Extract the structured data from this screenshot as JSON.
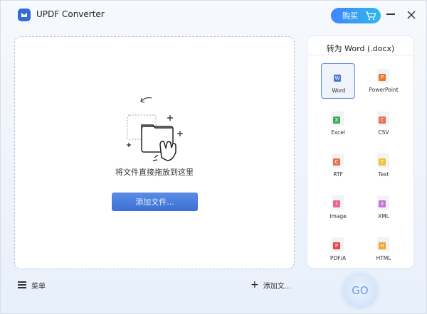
{
  "app": {
    "title": "UPDF Converter"
  },
  "titlebar": {
    "buy_label": "购买"
  },
  "dropzone": {
    "hint": "将文件直接拖放到这里",
    "add_button": "添加文件..."
  },
  "panel": {
    "title": "转为 Word (.docx)",
    "formats": [
      {
        "label": "Word",
        "badge": "W",
        "color": "#4a76d4",
        "selected": true
      },
      {
        "label": "PowerPoint",
        "badge": "P",
        "color": "#e6792f",
        "selected": false
      },
      {
        "label": "Excel",
        "badge": "X",
        "color": "#3fae5a",
        "selected": false
      },
      {
        "label": "CSV",
        "badge": "C",
        "color": "#e8704d",
        "selected": false
      },
      {
        "label": "RTF",
        "badge": "C",
        "color": "#e8704d",
        "selected": false
      },
      {
        "label": "Text",
        "badge": "T",
        "color": "#f1c232",
        "selected": false
      },
      {
        "label": "Image",
        "badge": "I",
        "color": "#e86a8a",
        "selected": false
      },
      {
        "label": "XML",
        "badge": "X",
        "color": "#c774d8",
        "selected": false
      },
      {
        "label": "PDF/A",
        "badge": "P",
        "color": "#e84a4a",
        "selected": false
      },
      {
        "label": "HTML",
        "badge": "H",
        "color": "#f0a732",
        "selected": false
      }
    ]
  },
  "bottom": {
    "menu_label": "菜单",
    "add_more_label": "添加文...",
    "go_label": "GO"
  },
  "colors": {
    "accent": "#3c70d3",
    "go_text": "#6b9bdc"
  }
}
